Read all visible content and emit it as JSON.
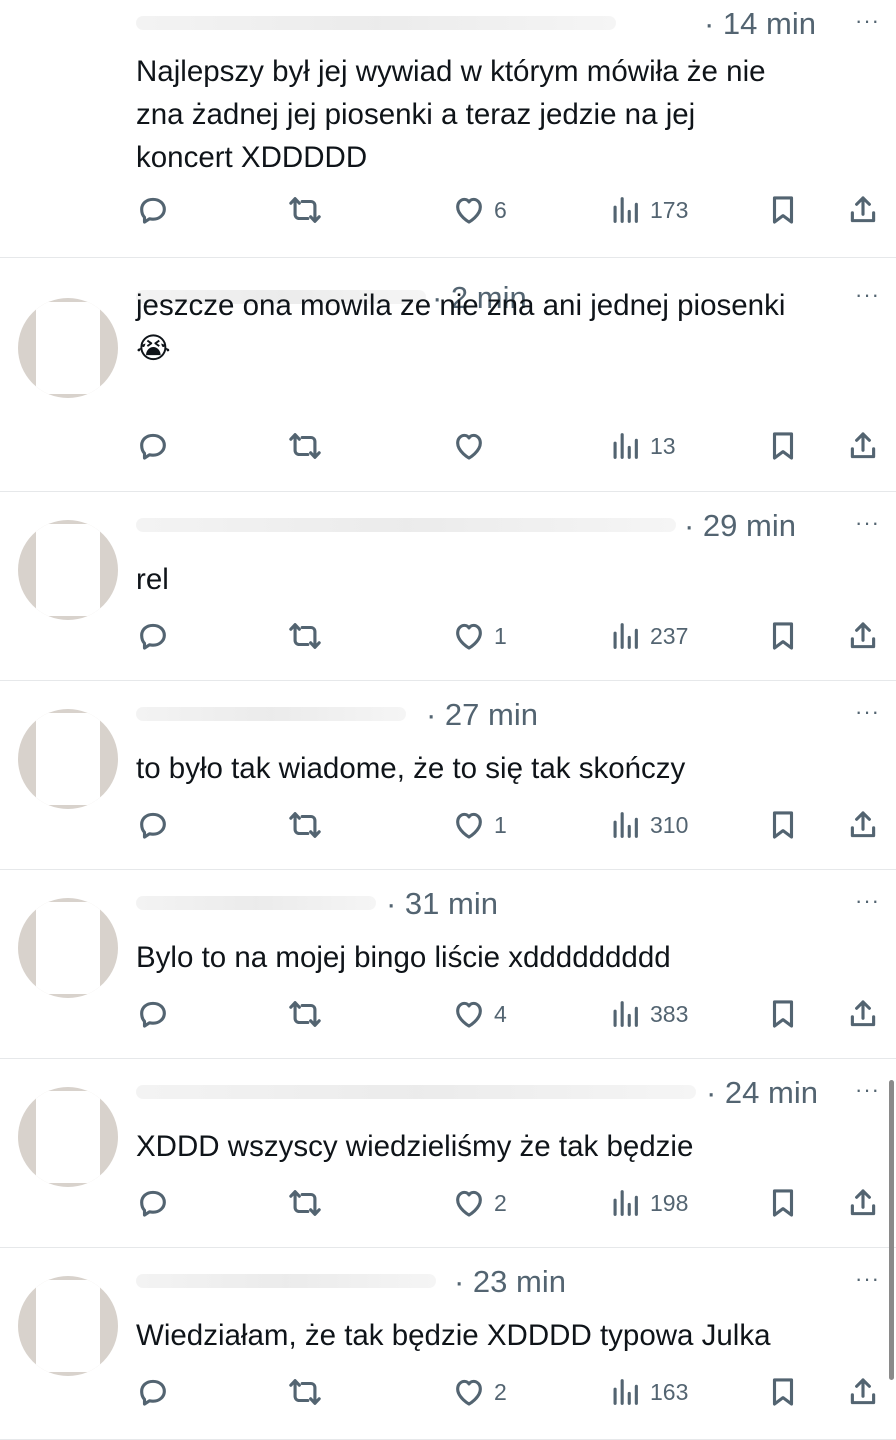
{
  "feed": {
    "replies": [
      {
        "time": "· 14 min",
        "more": "···",
        "text": "Najlepszy był jej wywiad w którym mówiła że nie\nzna żadnej jej piosenki a teraz jedzie na jej\nkoncert XDDDDD",
        "likes": "6",
        "views": "173"
      },
      {
        "time": "· 2 min",
        "more": "···",
        "text": "jeszcze ona mowila ze nie zna ani jednej piosenki\n😭",
        "likes": "",
        "views": "13"
      },
      {
        "time": "· 29 min",
        "more": "···",
        "text": "rel",
        "likes": "1",
        "views": "237"
      },
      {
        "time": "· 27 min",
        "more": "···",
        "text": "to było tak wiadome, że to się tak skończy",
        "likes": "1",
        "views": "310"
      },
      {
        "time": "· 31 min",
        "more": "···",
        "text": "Bylo to na mojej bingo liście xddddddddd",
        "likes": "4",
        "views": "383"
      },
      {
        "time": "· 24 min",
        "more": "···",
        "text": "XDDD wszyscy wiedzieliśmy że tak będzie",
        "likes": "2",
        "views": "198"
      },
      {
        "time": "· 23 min",
        "more": "···",
        "text": "Wiedziałam, że tak będzie XDDDD typowa Julka",
        "likes": "2",
        "views": "163"
      }
    ]
  },
  "icons": {
    "reply": "reply-icon",
    "repost": "repost-icon",
    "like": "heart-icon",
    "views": "views-icon",
    "bookmark": "bookmark-icon",
    "share": "share-icon"
  },
  "colors": {
    "text": "#0f1419",
    "muted": "#536471",
    "divider": "#e6e8ea"
  }
}
